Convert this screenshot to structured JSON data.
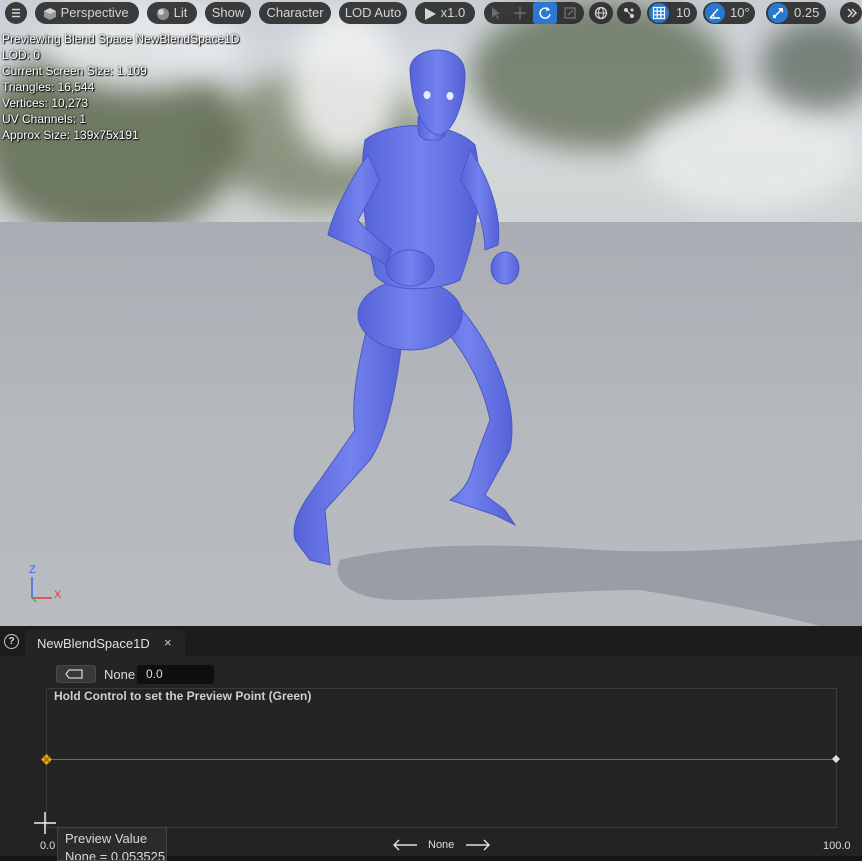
{
  "toolbar": {
    "menu_icon": "hamburger-icon",
    "view_mode": "Perspective",
    "lighting": "Lit",
    "show": "Show",
    "character": "Character",
    "lod": "LOD Auto",
    "play_rate": "x1.0",
    "grid_snap_value": "10",
    "rotation_snap_value": "10°",
    "scale_snap_value": "0.25",
    "active_accent": "#2a79d1"
  },
  "stats": [
    "Previewing Blend Space NewBlendSpace1D",
    "LOD: 0",
    "Current Screen Size: 1.109",
    "Triangles: 16,544",
    "Vertices: 10,273",
    "UV Channels: 1",
    "Approx Size: 139x75x191"
  ],
  "gizmo": {
    "z": "Z",
    "x": "X"
  },
  "panel": {
    "tab_label": "NewBlendSpace1D",
    "tab_close": "×",
    "parameter_name": "None",
    "parameter_value": "0.0",
    "hint": "Hold Control to set the Preview Point (Green)",
    "tooltip_title": "Preview Value",
    "tooltip_value": "None = 0.053525",
    "axis_min": "0.0",
    "axis_max": "100.0",
    "axis_name": "None",
    "axis_color": "#6e6a50",
    "sample_color": "#e3a21a"
  },
  "character_color": "#6b78e6"
}
